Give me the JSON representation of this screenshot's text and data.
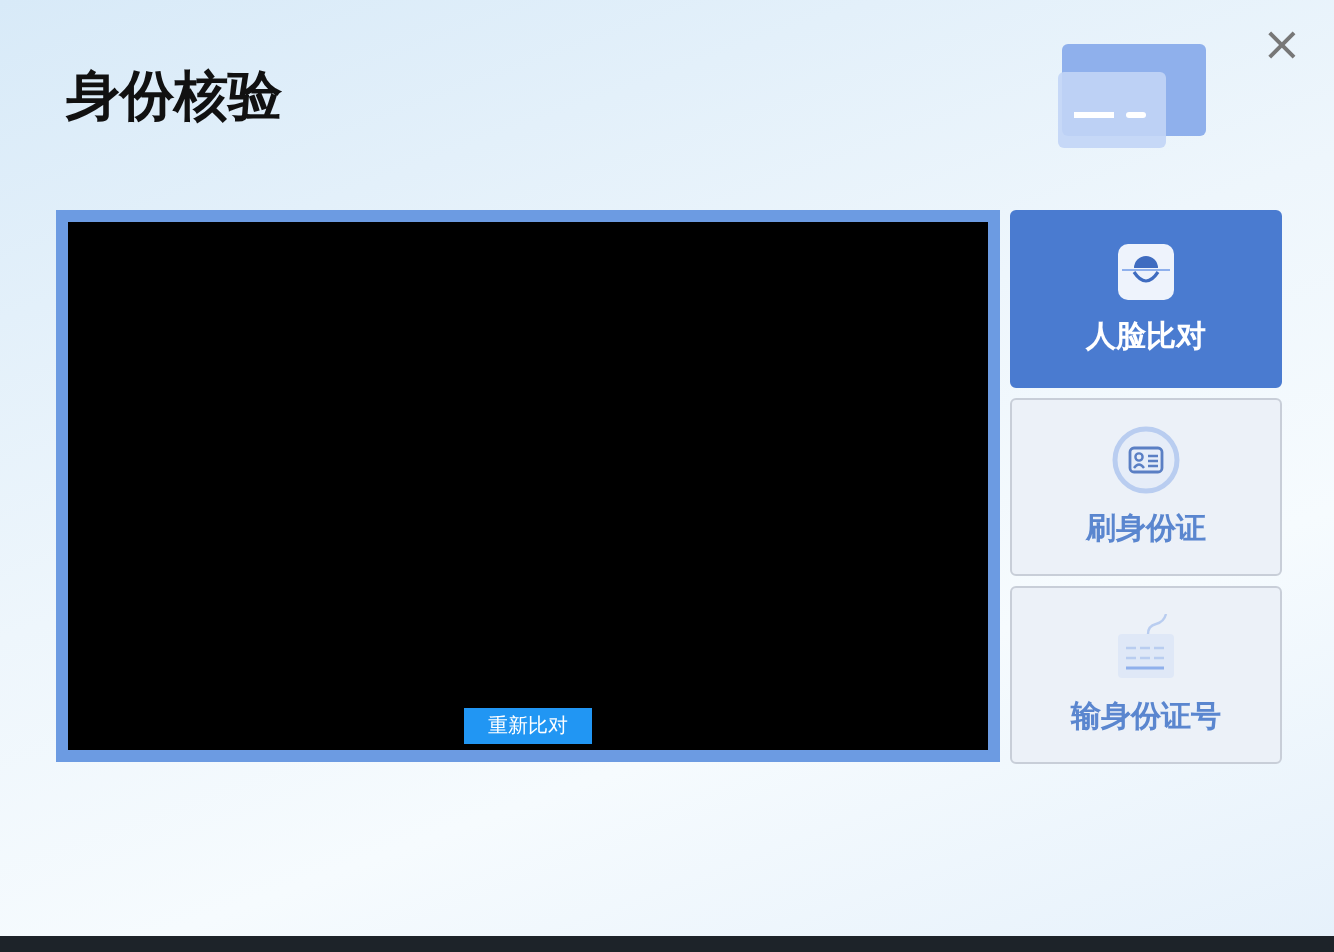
{
  "window": {
    "title": "身份核验",
    "close": "×"
  },
  "video": {
    "retry_button": "重新比对"
  },
  "methods": [
    {
      "kind": "face",
      "label": "人脸比对",
      "selected": true
    },
    {
      "kind": "card",
      "label": "刷身份证",
      "selected": false
    },
    {
      "kind": "keyboard",
      "label": "输身份证号",
      "selected": false
    }
  ]
}
